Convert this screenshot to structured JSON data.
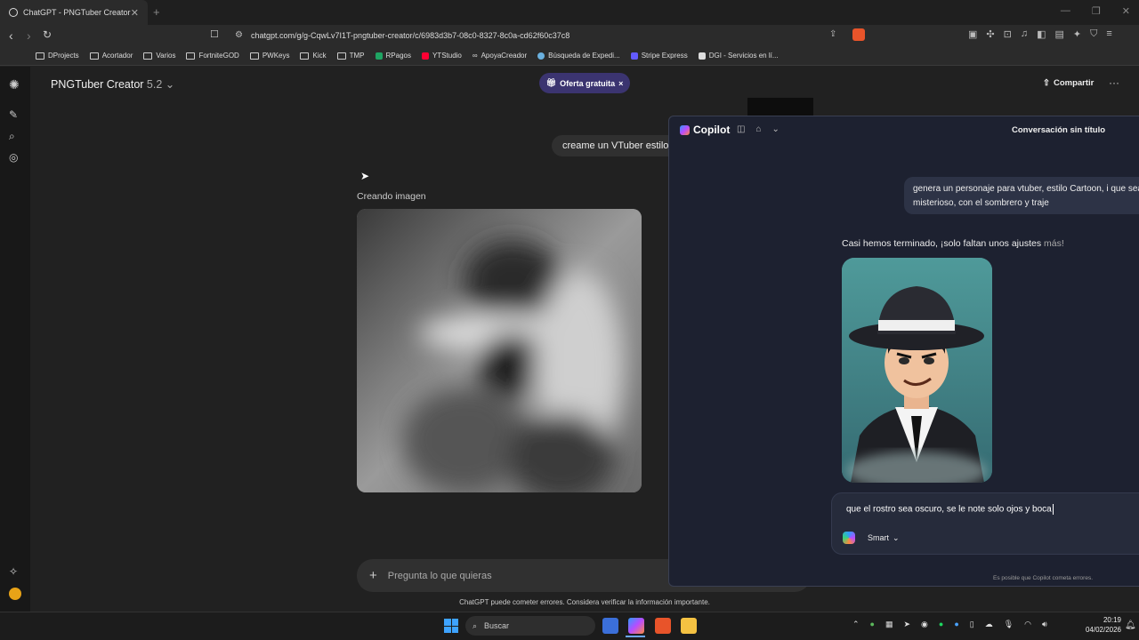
{
  "browser": {
    "tab_title": "ChatGPT - PNGTuber Creator",
    "url": "chatgpt.com/g/g-CqwLv7I1T-pngtuber-creator/c/6983d3b7-08c0-8327-8c0a-cd62f60c37c8",
    "bookmarks": [
      "DProjects",
      "Acortador",
      "Varios",
      "FortniteGOD",
      "PWKeys",
      "Kick",
      "TMP",
      "RPagos",
      "YTStudio",
      "ApoyaCreador",
      "Búsqueda de Expedi...",
      "Stripe Express",
      "DGI - Servicios en lí..."
    ]
  },
  "chatgpt": {
    "model_name": "PNGTuber Creator",
    "model_version": "5.2",
    "offer_label": "Oferta gratuita",
    "share_label": "Compartir",
    "user_message": "creame un VTuber estilo c",
    "creating_label": "Creando imagen",
    "prompt_placeholder": "Pregunta lo que quieras",
    "disclaimer": "ChatGPT puede cometer errores. Considera verificar la información importante."
  },
  "copilot": {
    "brand": "Copilot",
    "conversation_title": "Conversación sin título",
    "user_message": "genera un personaje para vtuber, estilo Cartoon, i que sea misterioso, con el sombrero y traje",
    "status_text": "Casi hemos terminado, ¡solo faltan unos ajustes",
    "status_text_muted": " más!",
    "input_value": "que el rostro sea oscuro, se le note solo ojos y boca",
    "mode_label": "Smart",
    "footer": "Es posible que Copilot cometa errores."
  },
  "taskbar": {
    "search_label": "Buscar",
    "time": "20:19",
    "date": "04/02/2026"
  }
}
